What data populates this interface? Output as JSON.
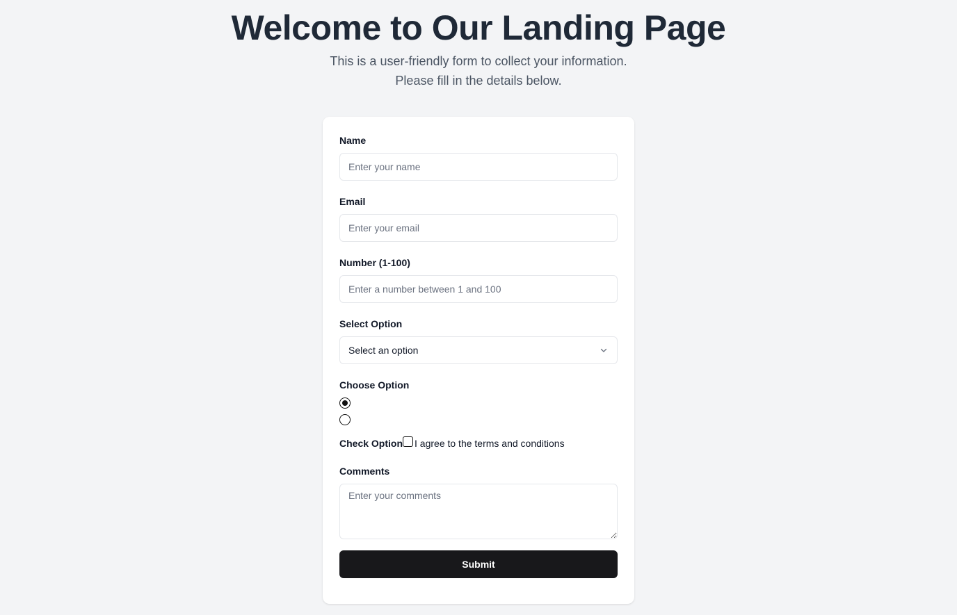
{
  "hero": {
    "title": "Welcome to Our Landing Page",
    "subtitle_line1": "This is a user-friendly form to collect your information.",
    "subtitle_line2": "Please fill in the details below."
  },
  "form": {
    "name": {
      "label": "Name",
      "placeholder": "Enter your name",
      "value": ""
    },
    "email": {
      "label": "Email",
      "placeholder": "Enter your email",
      "value": ""
    },
    "number": {
      "label": "Number (1-100)",
      "placeholder": "Enter a number between 1 and 100",
      "value": ""
    },
    "select": {
      "label": "Select Option",
      "selected": "Select an option"
    },
    "radio": {
      "label": "Choose Option",
      "options": [
        {
          "checked": true
        },
        {
          "checked": false
        }
      ]
    },
    "checkbox": {
      "label": "Check Option",
      "text": "I agree to the terms and conditions",
      "checked": false
    },
    "comments": {
      "label": "Comments",
      "placeholder": "Enter your comments",
      "value": ""
    },
    "submit_label": "Submit"
  },
  "icons": {
    "select_chevron": "chevron-down-icon"
  },
  "colors": {
    "background": "#f3f4f6",
    "button": "#18181b",
    "title": "#1f2937"
  }
}
